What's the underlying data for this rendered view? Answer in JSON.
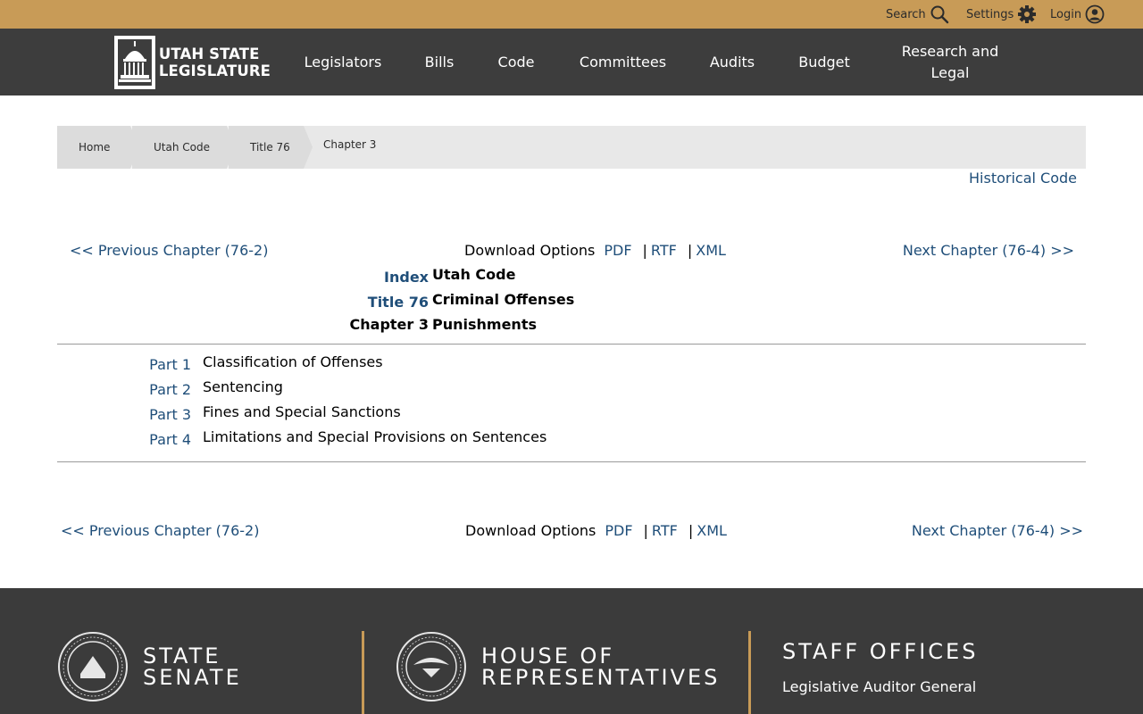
{
  "topbar": {
    "search": "Search",
    "settings": "Settings",
    "login": "Login"
  },
  "logo": {
    "line1": "UTAH STATE",
    "line2": "LEGISLATURE"
  },
  "nav": {
    "legislators": "Legislators",
    "bills": "Bills",
    "code": "Code",
    "committees": "Committees",
    "audits": "Audits",
    "budget": "Budget",
    "research": "Research and Legal"
  },
  "breadcrumb": {
    "home": "Home",
    "utah_code": "Utah Code",
    "title": "Title 76",
    "chapter": "Chapter 3"
  },
  "historical_code": "Historical Code",
  "chapter_nav": {
    "prev": "<< Previous Chapter (76-2)",
    "next": "Next Chapter (76-4) >>",
    "download_label": "Download Options",
    "pdf": "PDF",
    "rtf": "RTF",
    "xml": "XML",
    "separator": "|"
  },
  "heading": {
    "index_label": "Index",
    "index_text": "Utah Code",
    "title_label": "Title 76",
    "title_text": "Criminal Offenses",
    "chapter_label": "Chapter 3",
    "chapter_text": "Punishments"
  },
  "parts": [
    {
      "num": "Part 1",
      "title": "Classification of Offenses"
    },
    {
      "num": "Part 2",
      "title": "Sentencing"
    },
    {
      "num": "Part 3",
      "title": "Fines and Special Sanctions"
    },
    {
      "num": "Part 4",
      "title": "Limitations and Special Provisions on Sentences"
    }
  ],
  "footer": {
    "senate_line1": "STATE",
    "senate_line2": "SENATE",
    "house_line1": "HOUSE OF",
    "house_line2": "REPRESENTATIVES",
    "staff_heading": "STAFF OFFICES",
    "staff_link1": "Legislative Auditor General"
  },
  "colors": {
    "topbar": "#c89b57",
    "navbar": "#3d3d3d",
    "link": "#1f4e79",
    "footer": "#3b3b3b"
  }
}
